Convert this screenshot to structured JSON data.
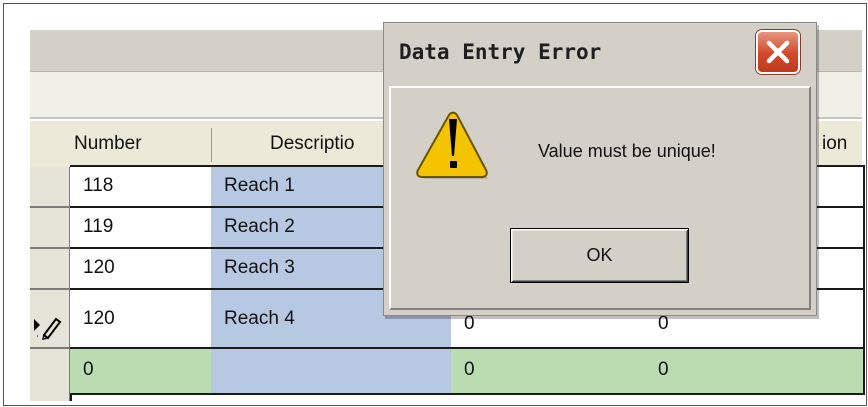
{
  "grid": {
    "headers": [
      "Number",
      "Descriptio",
      "ion"
    ],
    "rows": [
      {
        "number": "118",
        "description": "Reach 1",
        "col3": "",
        "col4": ""
      },
      {
        "number": "119",
        "description": "Reach 2",
        "col3": "",
        "col4": ""
      },
      {
        "number": "120",
        "description": "Reach 3",
        "col3": "",
        "col4": ""
      },
      {
        "number": "120",
        "description": "Reach 4",
        "col3": "0",
        "col4": "0"
      }
    ],
    "new_row": {
      "number": "0",
      "description": "",
      "col3": "0",
      "col4": "0"
    }
  },
  "dialog": {
    "title": "Data Entry Error",
    "message": "Value must be unique!",
    "ok_label": "OK",
    "icons": {
      "warning": "warning-icon",
      "close": "close-icon"
    }
  },
  "colors": {
    "description_column": "#b7c9e2",
    "new_row": "#b9dcb1",
    "close_button": "#d2492a",
    "warning": "#f5c400"
  }
}
